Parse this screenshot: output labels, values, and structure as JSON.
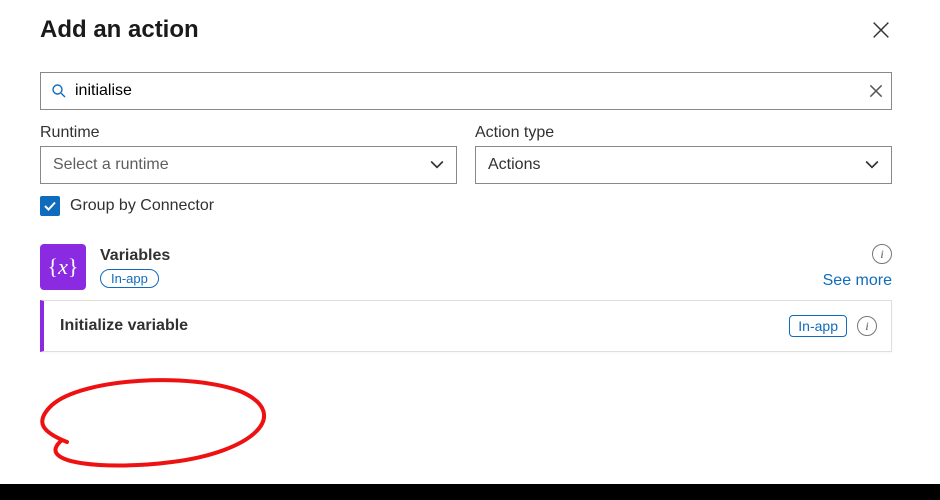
{
  "header": {
    "title": "Add an action"
  },
  "search": {
    "value": "initialise"
  },
  "filters": {
    "runtime": {
      "label": "Runtime",
      "placeholder": "Select a runtime"
    },
    "actiontype": {
      "label": "Action type",
      "value": "Actions"
    }
  },
  "checkbox": {
    "label": "Group by Connector",
    "checked": true
  },
  "connector": {
    "name": "Variables",
    "badge": "In-app",
    "see_more": "See more"
  },
  "action": {
    "name": "Initialize variable",
    "badge": "In-app"
  }
}
